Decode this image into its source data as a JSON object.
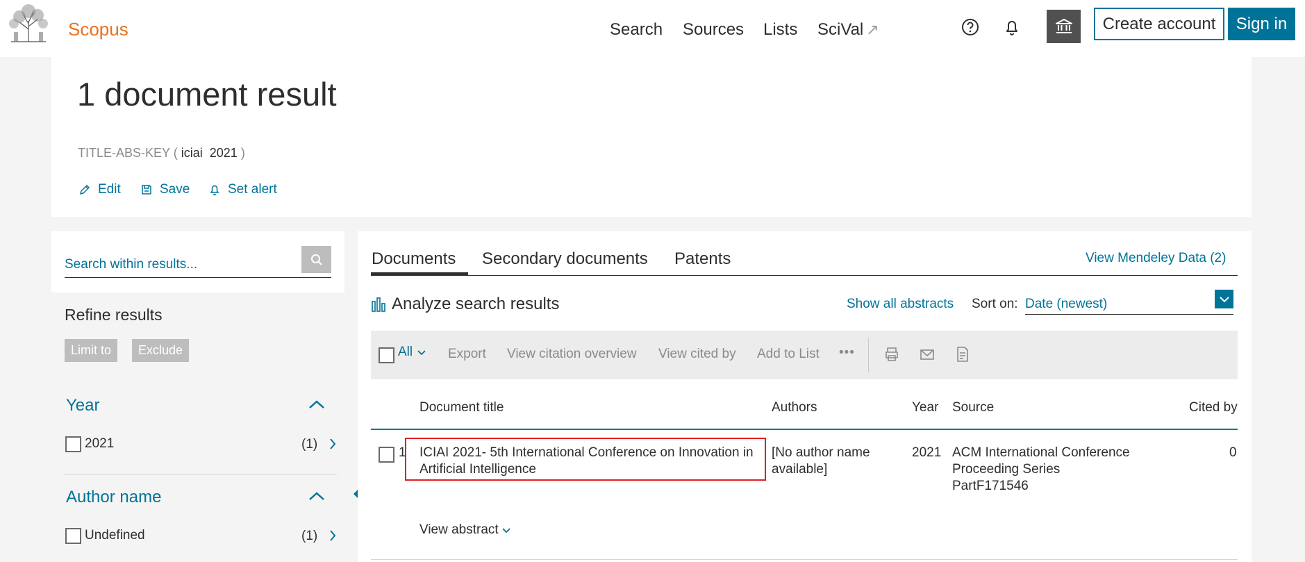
{
  "header": {
    "brand": "Scopus",
    "nav": [
      {
        "label": "Search"
      },
      {
        "label": "Sources"
      },
      {
        "label": "Lists"
      },
      {
        "label": "SciVal"
      }
    ],
    "scival_external_icon": "↗",
    "icons": [
      "help-icon",
      "bell-icon",
      "institution-icon"
    ],
    "create_account": "Create account",
    "sign_in": "Sign in"
  },
  "query": {
    "title": "1 document result",
    "field": "TITLE-ABS-KEY",
    "open_paren": "(",
    "terms": "iciai  2021",
    "close_paren": ")",
    "actions": [
      {
        "label": "Edit",
        "icon": "pencil-icon"
      },
      {
        "label": "Save",
        "icon": "floppy-disk-icon"
      },
      {
        "label": "Set alert",
        "icon": "bell-icon"
      }
    ]
  },
  "refine": {
    "search_placeholder": "Search within results...",
    "title": "Refine results",
    "limit_to": "Limit to",
    "exclude": "Exclude",
    "facets": [
      {
        "title": "Year",
        "items": [
          {
            "label": "2021",
            "count": "(1)"
          }
        ]
      },
      {
        "title": "Author name",
        "items": [
          {
            "label": "Undefined",
            "count": "(1)"
          }
        ]
      }
    ]
  },
  "results": {
    "tabs": [
      {
        "label": "Documents",
        "active": true
      },
      {
        "label": "Secondary documents",
        "active": false
      },
      {
        "label": "Patents",
        "active": false
      }
    ],
    "mendeley": "View Mendeley Data (2)",
    "analyze": "Analyze search results",
    "show_all_abstracts": "Show all abstracts",
    "sort_label": "Sort on:",
    "sort_value": "Date (newest)",
    "toolbar": {
      "all": "All",
      "export": "Export",
      "citation_overview": "View citation overview",
      "cited_by": "View cited by",
      "add_to_list": "Add to List",
      "more": "•••"
    },
    "columns": {
      "title": "Document title",
      "authors": "Authors",
      "year": "Year",
      "source": "Source",
      "cited_by": "Cited by"
    },
    "rows": [
      {
        "index": "1",
        "title_line1": "ICIAI 2021- 5th International Conference on Innovation in",
        "title_line2": "Artificial Intelligence",
        "authors_line1": "[No author name",
        "authors_line2": "available]",
        "year": "2021",
        "source_line1": "ACM International Conference",
        "source_line2": "Proceeding Series",
        "source_line3": "PartF171546",
        "cited_by": "0",
        "view_abstract": "View abstract"
      }
    ]
  },
  "colors": {
    "brand": "#e9711c",
    "link": "#007398",
    "highlight": "#e02020"
  }
}
